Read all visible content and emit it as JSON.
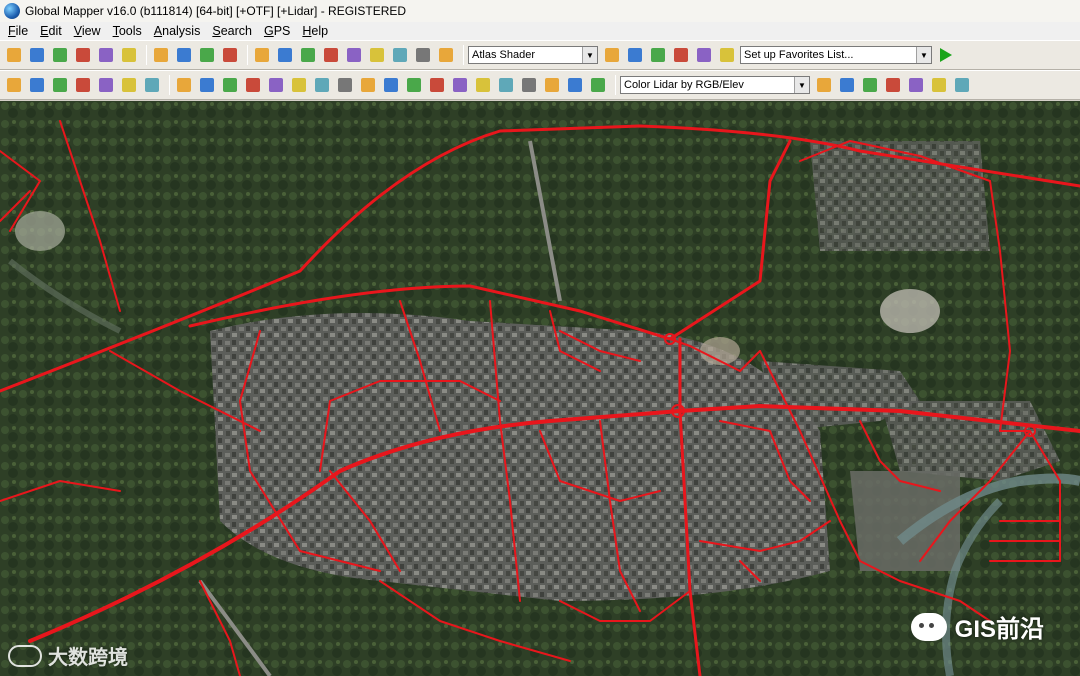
{
  "window": {
    "title": "Global Mapper v16.0 (b111814) [64-bit] [+OTF] [+Lidar] - REGISTERED"
  },
  "menu": [
    "File",
    "Edit",
    "View",
    "Tools",
    "Analysis",
    "Search",
    "GPS",
    "Help"
  ],
  "toolbar1": {
    "buttons_left": [
      "open-folder-icon",
      "save-icon",
      "globe-icon",
      "layers-icon",
      "image-icon",
      "config-icon"
    ],
    "buttons_zoom": [
      "zoom-in-icon",
      "zoom-out-icon",
      "zoom-full-icon",
      "home-icon"
    ],
    "buttons_tools": [
      "select-icon",
      "pan-icon",
      "measure-icon",
      "info-icon",
      "feature-icon",
      "digitize-icon",
      "edit-icon",
      "dropdown-tool-icon",
      "binoculars-icon"
    ],
    "shader_select": "Atlas Shader",
    "buttons_mid": [
      "palette-icon",
      "3d-icon",
      "terrain-icon",
      "ruler-icon",
      "view-icon",
      "path-icon"
    ],
    "favorites_select": "Set up Favorites List...",
    "run_button": "run-icon"
  },
  "toolbar2": {
    "buttons_left": [
      "gps-track-icon",
      "route-icon",
      "path-profile-icon",
      "link-icon",
      "area-icon",
      "volume-icon",
      "grid-icon"
    ],
    "buttons_edit": [
      "point-edit-icon",
      "vertex-icon",
      "line-tool-icon",
      "feature-tool-1-icon",
      "feature-tool-2-icon",
      "feature-tool-3-icon",
      "feature-tool-4-icon",
      "feature-tool-5-icon",
      "feature-tool-6-icon",
      "feature-tool-7-icon",
      "feature-tool-8-icon",
      "feature-tool-9-icon",
      "feature-tool-10-icon",
      "feature-tool-11-icon",
      "feature-tool-12-icon",
      "feature-tool-13-icon",
      "reshape-icon",
      "arrow-icon",
      "undo-shape-icon"
    ],
    "lidar_select": "Color Lidar by RGB/Elev",
    "buttons_right": [
      "lidar-lv-icon",
      "lidar-mv-icon",
      "lidar-hv-icon",
      "lidar-buildings-icon",
      "lidar-people-icon",
      "lidar-water-icon",
      "lidar-more-icon"
    ]
  },
  "colors": {
    "road": "#e8161c",
    "map_base": "#4a5a3c",
    "toolbar": "#ece9e2"
  },
  "watermarks": {
    "left": "大数跨境",
    "right": "GIS前沿"
  }
}
